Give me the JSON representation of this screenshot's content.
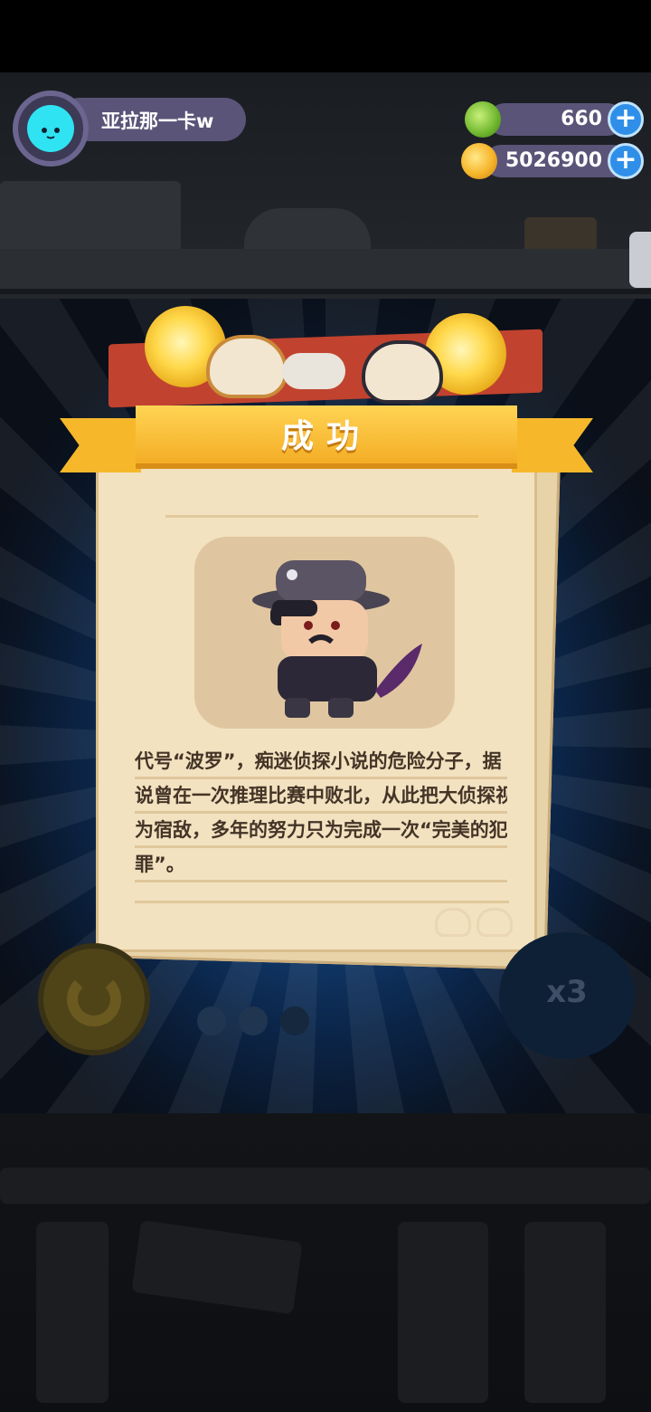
{
  "profile": {
    "name": "亚拉那一卡w",
    "avatar_icon": "cat-face-icon"
  },
  "currencies": [
    {
      "name": "green-gem",
      "value": "660",
      "icon": "green-coin-icon",
      "color": "#7cc63a"
    },
    {
      "name": "gold-coin",
      "value": "5026900",
      "icon": "gold-planet-icon",
      "color": "#f6b52a"
    }
  ],
  "modal": {
    "title": "成功",
    "description_lines": [
      "代号“波罗”，痴迷侦探小说的危险分子，据",
      "说曾在一次推理比赛中败北，从此把大侦探视",
      "为宿敌，多年的努力只为完成一次“完美的犯",
      "罪”。"
    ],
    "portrait_icon": "detective-character-icon"
  },
  "controls": {
    "restart_icon": "restart-icon",
    "speed_label": "x3"
  },
  "colors": {
    "banner": "#f4ad25",
    "paper": "#f2e2c0",
    "plus_button": "#2f8fe8"
  }
}
